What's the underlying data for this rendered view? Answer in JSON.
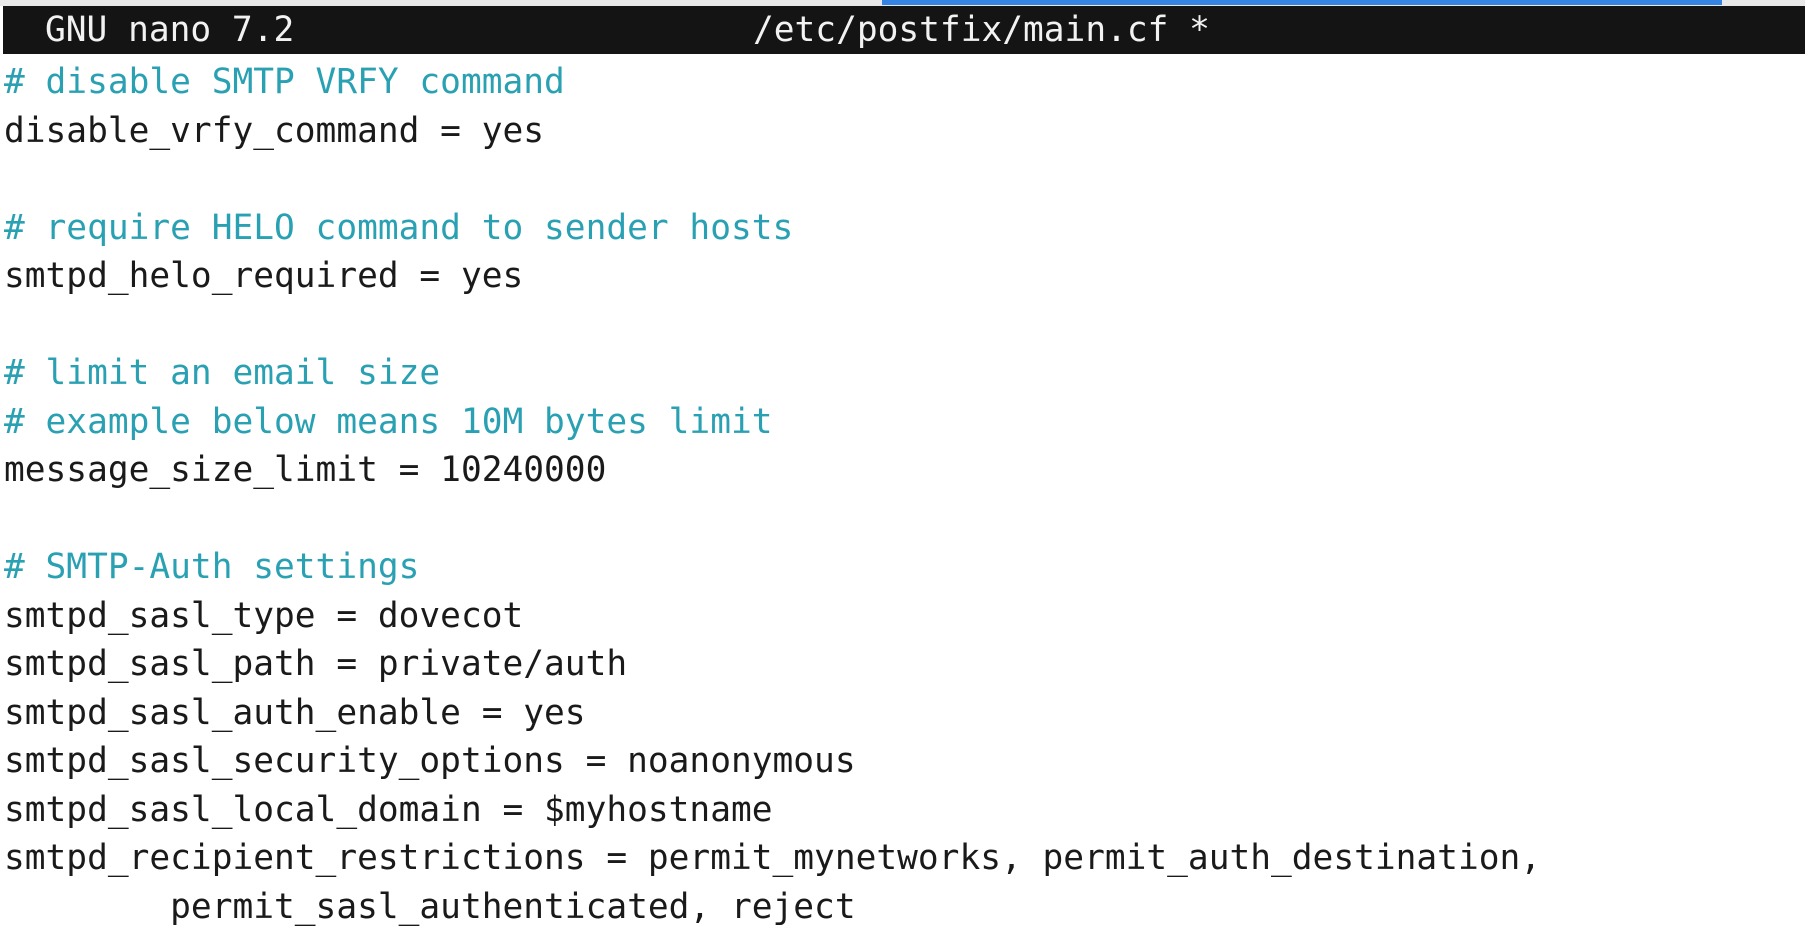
{
  "titlebar": {
    "app": "GNU nano 7.2",
    "filename": "/etc/postfix/main.cf *"
  },
  "colors": {
    "comment": "#2aa1b3",
    "text": "#1a1a1a",
    "titlebar_bg": "#141414",
    "selection": "#3584e4"
  },
  "lines": [
    {
      "kind": "comment",
      "text": "# disable SMTP VRFY command"
    },
    {
      "kind": "setting",
      "text": "disable_vrfy_command = yes"
    },
    {
      "kind": "blank",
      "text": ""
    },
    {
      "kind": "comment",
      "text": "# require HELO command to sender hosts"
    },
    {
      "kind": "setting",
      "text": "smtpd_helo_required = yes"
    },
    {
      "kind": "blank",
      "text": ""
    },
    {
      "kind": "comment",
      "text": "# limit an email size"
    },
    {
      "kind": "comment",
      "text": "# example below means 10M bytes limit"
    },
    {
      "kind": "setting",
      "text": "message_size_limit = 10240000"
    },
    {
      "kind": "blank",
      "text": ""
    },
    {
      "kind": "comment",
      "text": "# SMTP-Auth settings"
    },
    {
      "kind": "setting",
      "text": "smtpd_sasl_type = dovecot"
    },
    {
      "kind": "setting",
      "text": "smtpd_sasl_path = private/auth"
    },
    {
      "kind": "setting",
      "text": "smtpd_sasl_auth_enable = yes"
    },
    {
      "kind": "setting",
      "text": "smtpd_sasl_security_options = noanonymous"
    },
    {
      "kind": "setting",
      "text": "smtpd_sasl_local_domain = $myhostname"
    },
    {
      "kind": "setting",
      "text": "smtpd_recipient_restrictions = permit_mynetworks, permit_auth_destination,"
    },
    {
      "kind": "setting",
      "text": "        permit_sasl_authenticated, reject"
    }
  ]
}
